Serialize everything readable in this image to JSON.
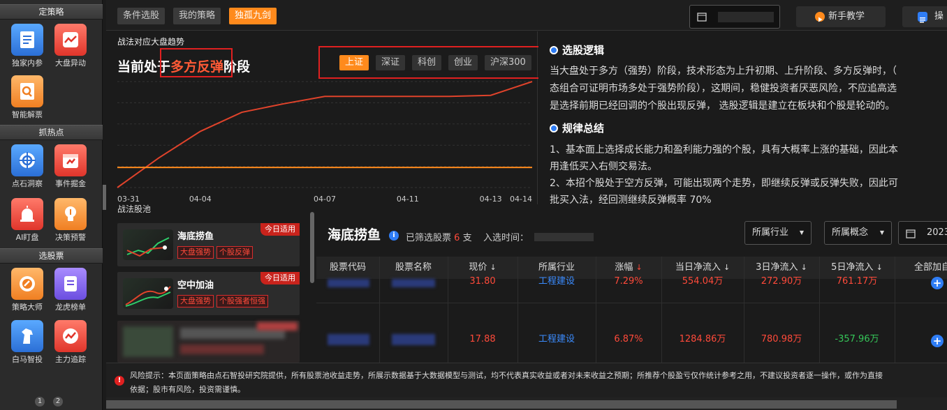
{
  "sidebar": {
    "sections": [
      {
        "title": "定策略",
        "items": [
          {
            "label": "独家内参",
            "icon": "report-icon"
          },
          {
            "label": "大盘异动",
            "icon": "market-alert-icon"
          },
          {
            "label": "智能解票",
            "icon": "magnify-stock-icon"
          }
        ]
      },
      {
        "title": "抓热点",
        "items": [
          {
            "label": "点石洞察",
            "icon": "insight-icon"
          },
          {
            "label": "事件掘金",
            "icon": "event-icon"
          },
          {
            "label": "AI盯盘",
            "icon": "alarm-icon"
          },
          {
            "label": "决策预警",
            "icon": "bulb-icon"
          }
        ]
      },
      {
        "title": "选股票",
        "items": [
          {
            "label": "策略大师",
            "icon": "strategy-icon"
          },
          {
            "label": "龙虎榜单",
            "icon": "scroll-icon"
          },
          {
            "label": "白马智投",
            "icon": "horse-icon"
          },
          {
            "label": "主力追踪",
            "icon": "trend-icon"
          }
        ]
      }
    ],
    "pages": [
      "1",
      "2"
    ]
  },
  "topbar": {
    "tabs": [
      "条件选股",
      "我的策略",
      "独孤九剑"
    ],
    "active_tab": 2,
    "tutorial": "新手教学",
    "operation": "操"
  },
  "chart_panel": {
    "subtitle": "战法对应大盘趋势",
    "title_prefix": "当前处于",
    "title_highlight": "多方反弹",
    "title_suffix": "阶段",
    "indices": [
      "上证",
      "深证",
      "科创",
      "创业",
      "沪深300"
    ],
    "active_index": 0
  },
  "chart_data": {
    "type": "line",
    "x": [
      "03-31",
      "04-03",
      "04-04",
      "04-05",
      "04-06",
      "04-07",
      "04-10",
      "04-11",
      "04-12",
      "04-13",
      "04-14"
    ],
    "x_tick_labels": [
      "03-31",
      "04-04",
      "04-07",
      "04-11",
      "04-13",
      "04-14"
    ],
    "series": [
      {
        "values": [
          0.0,
          0.28,
          0.53,
          0.71,
          0.79,
          0.86,
          0.86,
          0.86,
          0.86,
          0.87,
          1.0
        ],
        "color": "#e0432b"
      },
      {
        "values": [
          0.19,
          0.19,
          0.19,
          0.19,
          0.19,
          0.19,
          0.19,
          0.19,
          0.19,
          0.19,
          0.19
        ],
        "color": "#ff8a1c"
      }
    ],
    "ylim": [
      0,
      1
    ],
    "grid": true
  },
  "logic": {
    "h1": "选股逻辑",
    "p1": [
      "当大盘处于多方（强势）阶段，技术形态为上升初期、上升阶段、多方反弹时，（",
      "态组合可证明市场多处于强势阶段），这期间，稳健投资者厌恶风险，不应追高选",
      "是选择前期已经回调的个股出现反弹， 选股逻辑是建立在板块和个股是轮动的。"
    ],
    "h2": "规律总结",
    "p2": [
      "1、基本面上选择成长能力和盈利能力强的个股，具有大概率上涨的基础，因此本",
      "用逢低买入右侧交易法。",
      "2、本招个股处于空方反弹，可能出现两个走势，即继续反弹或反弹失败，因此可",
      "批买入法，经回测继续反弹概率 70%"
    ]
  },
  "pool": {
    "header": "战法股池",
    "cards": [
      {
        "name": "海底捞鱼",
        "badge": "今日适用",
        "tags": [
          "大盘强势",
          "个股反弹"
        ]
      },
      {
        "name": "空中加油",
        "badge": "今日适用",
        "tags": [
          "大盘强势",
          "个股强者恒强"
        ]
      }
    ]
  },
  "table": {
    "title": "海底捞鱼",
    "filtered_label": "已筛选股票",
    "filtered_count": "6",
    "filtered_unit": "支",
    "join_label": "入选时间：",
    "filters": [
      "所属行业",
      "所属概念"
    ],
    "date_prefix": "2023",
    "columns": [
      "股票代码",
      "股票名称",
      "现价",
      "所属行业",
      "涨幅",
      "当日净流入",
      "3日净流入",
      "5日净流入",
      "全部加自"
    ],
    "rows": [
      {
        "price": "31.80",
        "industry": "工程建设",
        "change": "7.29%",
        "today": "554.04万",
        "d3": "272.90万",
        "d5": "761.17万"
      },
      {
        "price": "17.88",
        "industry": "工程建设",
        "change": "6.87%",
        "today": "1284.86万",
        "d3": "780.98万",
        "d5": "-357.96万"
      }
    ]
  },
  "risk": {
    "line1": "风险提示：本页面策略由点石智投研究院提供，所有股票池收益走势，所展示数据基于大数据模型与测试，均不代表真实收益或者对未来收益之预期；所推荐个股盈亏仅作统计参考之用，不建议投资者逐一操作，或作为直接",
    "line2": "依据；股市有风险，投资需谨慎。"
  }
}
